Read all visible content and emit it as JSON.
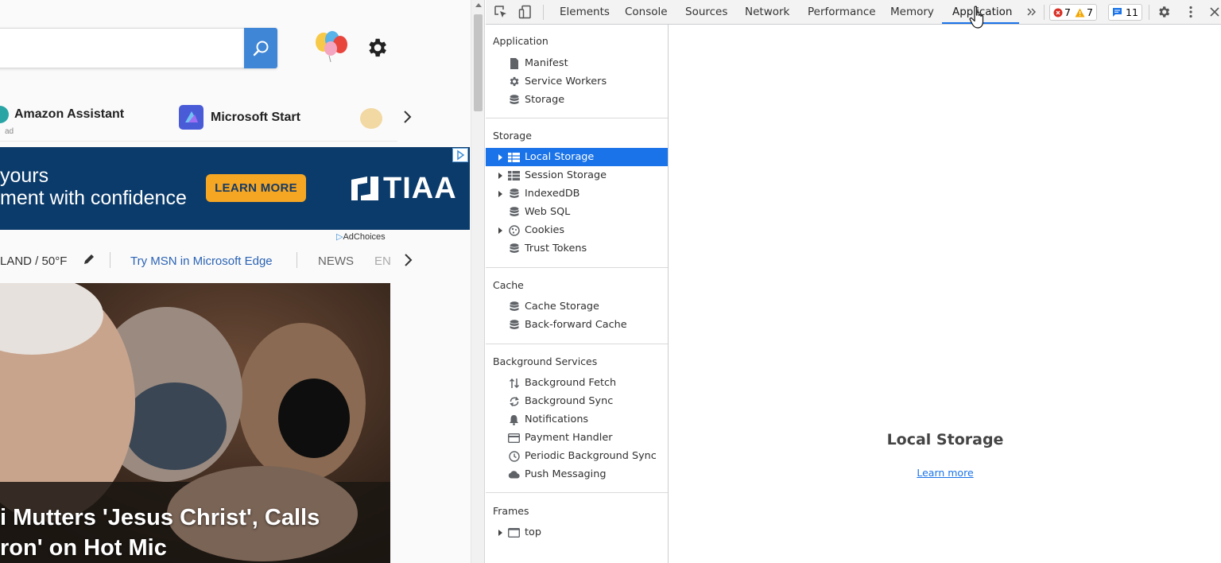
{
  "msn": {
    "quicklinks": [
      {
        "label": "Amazon Assistant",
        "sub": "ad"
      },
      {
        "label": "Microsoft Start"
      }
    ],
    "ad": {
      "line1": "yours",
      "line2": "ment with confidence",
      "button": "LEARN MORE",
      "brand": "TIAA",
      "adchoices": "AdChoices"
    },
    "navbar": {
      "weather": "LAND / 50°F",
      "edge_link": "Try MSN in Microsoft Edge",
      "news": "NEWS",
      "en": "EN"
    },
    "headline": {
      "line1": "i Mutters 'Jesus Christ', Calls",
      "line2": "ron' on Hot Mic"
    }
  },
  "devtools": {
    "tabs": [
      "Elements",
      "Console",
      "Sources",
      "Network",
      "Performance",
      "Memory",
      "Application"
    ],
    "active_tab": "Application",
    "badges": {
      "errors": "7",
      "warnings": "7",
      "messages": "11"
    },
    "sidebar": {
      "application": {
        "title": "Application",
        "items": [
          "Manifest",
          "Service Workers",
          "Storage"
        ]
      },
      "storage": {
        "title": "Storage",
        "items": [
          "Local Storage",
          "Session Storage",
          "IndexedDB",
          "Web SQL",
          "Cookies",
          "Trust Tokens"
        ]
      },
      "cache": {
        "title": "Cache",
        "items": [
          "Cache Storage",
          "Back-forward Cache"
        ]
      },
      "background": {
        "title": "Background Services",
        "items": [
          "Background Fetch",
          "Background Sync",
          "Notifications",
          "Payment Handler",
          "Periodic Background Sync",
          "Push Messaging"
        ]
      },
      "frames": {
        "title": "Frames",
        "items": [
          "top"
        ]
      }
    },
    "main": {
      "title": "Local Storage",
      "learn_more": "Learn more"
    }
  },
  "colors": {
    "selected": "#1a73e8",
    "ad_bg": "#0b3b6b",
    "ad_button": "#f5a623",
    "search_button": "#3f86d6"
  }
}
